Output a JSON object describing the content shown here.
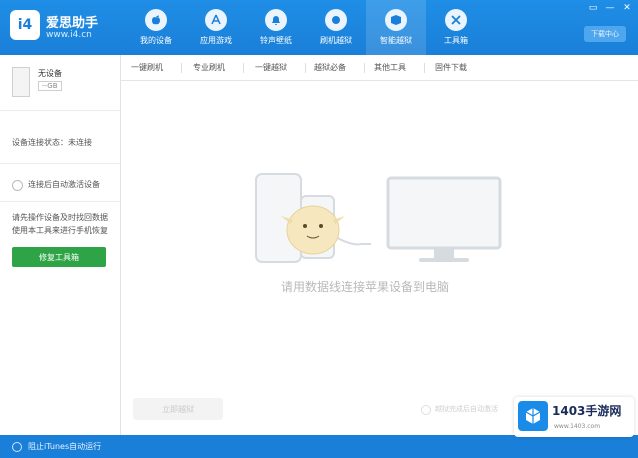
{
  "app": {
    "logo_text": "i4",
    "brand_name": "爱思助手",
    "brand_url": "www.i4.cn"
  },
  "nav": [
    {
      "label": "我的设备",
      "icon": "apple-icon"
    },
    {
      "label": "应用游戏",
      "icon": "appstore-icon"
    },
    {
      "label": "铃声壁纸",
      "icon": "bell-icon"
    },
    {
      "label": "刷机越狱",
      "icon": "flash-icon"
    },
    {
      "label": "智能越狱",
      "icon": "box-icon",
      "active": true
    },
    {
      "label": "工具箱",
      "icon": "tools-icon"
    }
  ],
  "window_controls": [
    "▭",
    "—",
    "✕"
  ],
  "download_button": "下载中心",
  "sidebar": {
    "device_name": "无设备",
    "device_tag": "--GB",
    "connection_status": "设备连接状态：未连接",
    "radio_label": "连接后自动激活设备",
    "tip": "请先操作设备及时找回数据使用本工具来进行手机恢复",
    "fix_button": "修复工具箱"
  },
  "tabs": [
    "一键刷机",
    "专业刷机",
    "一键越狱",
    "越狱必备",
    "其他工具",
    "固件下载"
  ],
  "main": {
    "message": "请用数据线连接苹果设备到电脑",
    "ghost_button": "立即越狱",
    "ghost_option": "越狱完成后自动激活"
  },
  "bottom": {
    "label": "阻止iTunes自动运行"
  },
  "watermark": {
    "text": "1403手游网",
    "url": "www.1403.com"
  },
  "colors": {
    "primary": "#1a7fd8",
    "green": "#2ea446"
  }
}
